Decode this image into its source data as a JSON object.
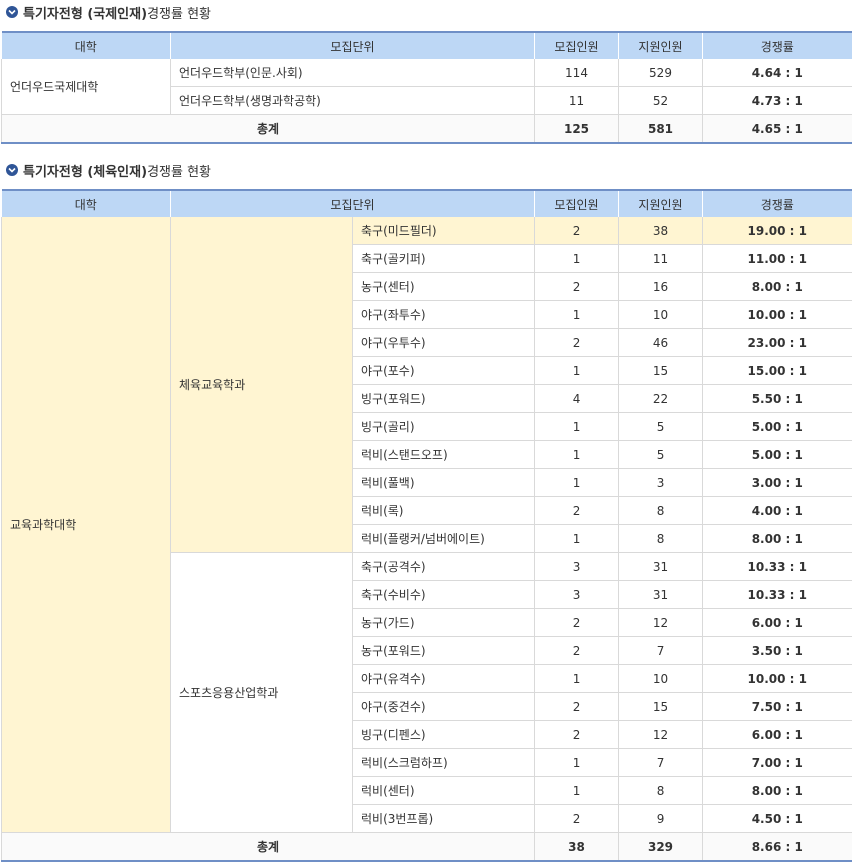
{
  "section1": {
    "title_bold": "특기자전형 (국제인재)",
    "title_rest": " 경쟁률 현황",
    "headers": [
      "대학",
      "모집단위",
      "모집인원",
      "지원인원",
      "경쟁률"
    ],
    "college": "언더우드국제대학",
    "rows": [
      {
        "unit": "언더우드학부(인문.사회)",
        "quota": "114",
        "applicants": "529",
        "ratio": "4.64 : 1"
      },
      {
        "unit": "언더우드학부(생명과학공학)",
        "quota": "11",
        "applicants": "52",
        "ratio": "4.73 : 1"
      }
    ],
    "total": {
      "label": "총계",
      "quota": "125",
      "applicants": "581",
      "ratio": "4.65 : 1"
    }
  },
  "section2": {
    "title_bold": "특기자전형 (체육인재)",
    "title_rest": " 경쟁률 현황",
    "headers": [
      "대학",
      "모집단위",
      "모집인원",
      "지원인원",
      "경쟁률"
    ],
    "college": "교육과학대학",
    "dept1": "체육교육학과",
    "dept2": "스포츠응용산업학과",
    "rows": [
      {
        "unit": "축구(미드필더)",
        "quota": "2",
        "applicants": "38",
        "ratio": "19.00 : 1"
      },
      {
        "unit": "축구(골키퍼)",
        "quota": "1",
        "applicants": "11",
        "ratio": "11.00 : 1"
      },
      {
        "unit": "농구(센터)",
        "quota": "2",
        "applicants": "16",
        "ratio": "8.00 : 1"
      },
      {
        "unit": "야구(좌투수)",
        "quota": "1",
        "applicants": "10",
        "ratio": "10.00 : 1"
      },
      {
        "unit": "야구(우투수)",
        "quota": "2",
        "applicants": "46",
        "ratio": "23.00 : 1"
      },
      {
        "unit": "야구(포수)",
        "quota": "1",
        "applicants": "15",
        "ratio": "15.00 : 1"
      },
      {
        "unit": "빙구(포워드)",
        "quota": "4",
        "applicants": "22",
        "ratio": "5.50 : 1"
      },
      {
        "unit": "빙구(골리)",
        "quota": "1",
        "applicants": "5",
        "ratio": "5.00 : 1"
      },
      {
        "unit": "럭비(스탠드오프)",
        "quota": "1",
        "applicants": "5",
        "ratio": "5.00 : 1"
      },
      {
        "unit": "럭비(풀백)",
        "quota": "1",
        "applicants": "3",
        "ratio": "3.00 : 1"
      },
      {
        "unit": "럭비(록)",
        "quota": "2",
        "applicants": "8",
        "ratio": "4.00 : 1"
      },
      {
        "unit": "럭비(플랭커/넘버에이트)",
        "quota": "1",
        "applicants": "8",
        "ratio": "8.00 : 1"
      },
      {
        "unit": "축구(공격수)",
        "quota": "3",
        "applicants": "31",
        "ratio": "10.33 : 1"
      },
      {
        "unit": "축구(수비수)",
        "quota": "3",
        "applicants": "31",
        "ratio": "10.33 : 1"
      },
      {
        "unit": "농구(가드)",
        "quota": "2",
        "applicants": "12",
        "ratio": "6.00 : 1"
      },
      {
        "unit": "농구(포워드)",
        "quota": "2",
        "applicants": "7",
        "ratio": "3.50 : 1"
      },
      {
        "unit": "야구(유격수)",
        "quota": "1",
        "applicants": "10",
        "ratio": "10.00 : 1"
      },
      {
        "unit": "야구(중견수)",
        "quota": "2",
        "applicants": "15",
        "ratio": "7.50 : 1"
      },
      {
        "unit": "빙구(디펜스)",
        "quota": "2",
        "applicants": "12",
        "ratio": "6.00 : 1"
      },
      {
        "unit": "럭비(스크럼하프)",
        "quota": "1",
        "applicants": "7",
        "ratio": "7.00 : 1"
      },
      {
        "unit": "럭비(센터)",
        "quota": "1",
        "applicants": "8",
        "ratio": "8.00 : 1"
      },
      {
        "unit": "럭비(3번프롭)",
        "quota": "2",
        "applicants": "9",
        "ratio": "4.50 : 1"
      }
    ],
    "total": {
      "label": "총계",
      "quota": "38",
      "applicants": "329",
      "ratio": "8.66 : 1"
    }
  },
  "colors": {
    "header_bg": "#bdd7f5",
    "border_accent": "#6f8fc6",
    "highlight": "#fff5d2",
    "icon": "#2f5597"
  }
}
